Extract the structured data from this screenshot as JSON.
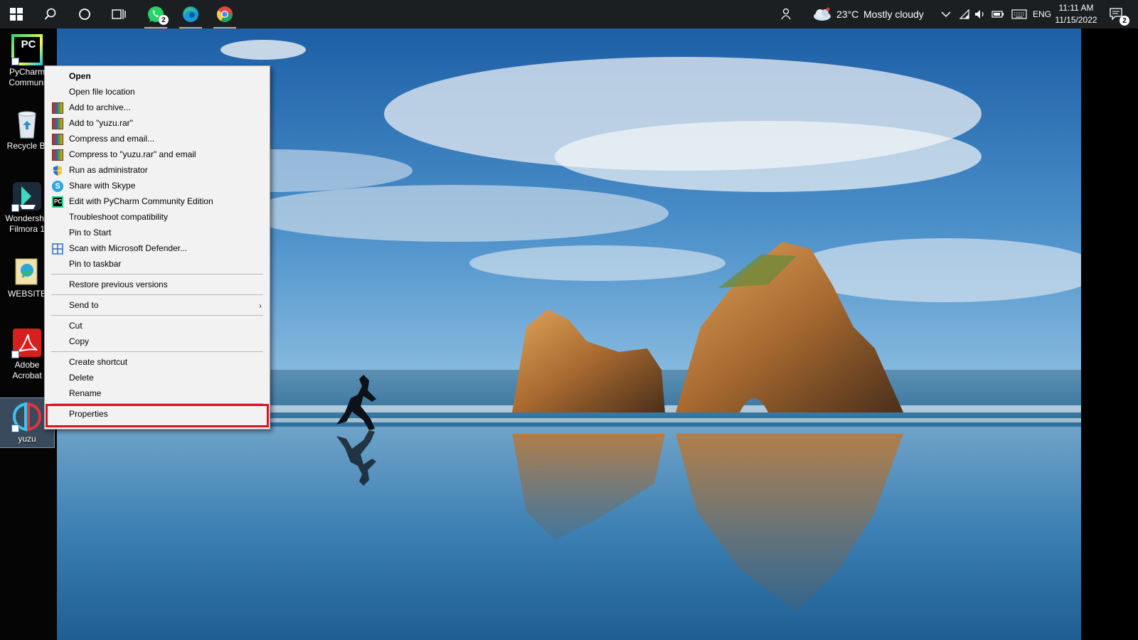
{
  "taskbar": {
    "apps": [
      {
        "name": "WhatsApp",
        "badge": "2"
      },
      {
        "name": "Microsoft Edge",
        "badge": ""
      },
      {
        "name": "Google Chrome",
        "badge": ""
      }
    ],
    "weather": {
      "temp": "23°C",
      "condition": "Mostly cloudy"
    },
    "language": "ENG",
    "time": "11:11 AM",
    "date": "11/15/2022",
    "notification_count": "2"
  },
  "desktop": {
    "icons": [
      {
        "line1": "PyCharm",
        "line2": "Communi"
      },
      {
        "line1": "Recycle Bi",
        "line2": ""
      },
      {
        "line1": "Wondersha",
        "line2": "Filmora 1"
      },
      {
        "line1": "WEBSITE",
        "line2": ""
      },
      {
        "line1": "Adobe",
        "line2": "Acrobat"
      },
      {
        "line1": "yuzu",
        "line2": ""
      }
    ]
  },
  "context_menu": {
    "items": [
      {
        "label": "Open"
      },
      {
        "label": "Open file location"
      },
      {
        "label": "Add to archive..."
      },
      {
        "label": "Add to \"yuzu.rar\""
      },
      {
        "label": "Compress and email..."
      },
      {
        "label": "Compress to \"yuzu.rar\" and email"
      },
      {
        "label": "Run as administrator"
      },
      {
        "label": "Share with Skype"
      },
      {
        "label": "Edit with PyCharm Community Edition"
      },
      {
        "label": "Troubleshoot compatibility"
      },
      {
        "label": "Pin to Start"
      },
      {
        "label": "Scan with Microsoft Defender..."
      },
      {
        "label": "Pin to taskbar"
      },
      {
        "label": "Restore previous versions"
      },
      {
        "label": "Send to"
      },
      {
        "label": "Cut"
      },
      {
        "label": "Copy"
      },
      {
        "label": "Create shortcut"
      },
      {
        "label": "Delete"
      },
      {
        "label": "Rename"
      },
      {
        "label": "Properties"
      }
    ],
    "highlighted": "Properties",
    "highlight_color": "#e01020"
  },
  "icons": {
    "pc_badge": "PC",
    "skype_letter": "S",
    "pycharm_small": "PC",
    "submenu_arrow": "›"
  }
}
